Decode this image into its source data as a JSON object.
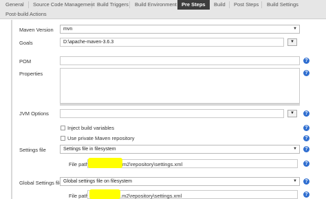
{
  "tabs": [
    {
      "label": "General"
    },
    {
      "label": "Source Code Management"
    },
    {
      "label": "Build Triggers"
    },
    {
      "label": "Build Environment"
    },
    {
      "label": "Pre Steps"
    },
    {
      "label": "Build"
    },
    {
      "label": "Post Steps"
    },
    {
      "label": "Build Settings"
    },
    {
      "label": "Post-build Actions"
    }
  ],
  "active_tab": "Pre Steps",
  "form": {
    "maven_version": {
      "label": "Maven Version",
      "value": "mvn"
    },
    "goals": {
      "label": "Goals",
      "value": "D:\\apache-maven-3.6.3",
      "expand_button": "▼"
    },
    "pom": {
      "label": "POM",
      "value": ""
    },
    "properties": {
      "label": "Properties",
      "value": ""
    },
    "jvm_options": {
      "label": "JVM Options",
      "value": "",
      "expand_button": "▼"
    },
    "inject_build_variables": {
      "label": "Inject build variables",
      "checked": false
    },
    "private_repository": {
      "label": "Use private Maven repository",
      "checked": false
    },
    "settings_file": {
      "label": "Settings file",
      "value": "Settings file in filesystem"
    },
    "settings_file_path": {
      "label": "File path",
      "value": "m2\\repository\\settings.xml"
    },
    "global_settings_file": {
      "label": "Global Settings file",
      "value": "Global settings file on filesystem"
    },
    "global_settings_file_path": {
      "label": "File path",
      "value": ".m2\\repository\\settings.xml"
    }
  },
  "icons": {
    "help": "?",
    "dropdown": "▼"
  },
  "colors": {
    "active_tab_bg": "#3d3d3d",
    "help_icon": "#2f6ed0",
    "redaction": "#ffff00"
  }
}
